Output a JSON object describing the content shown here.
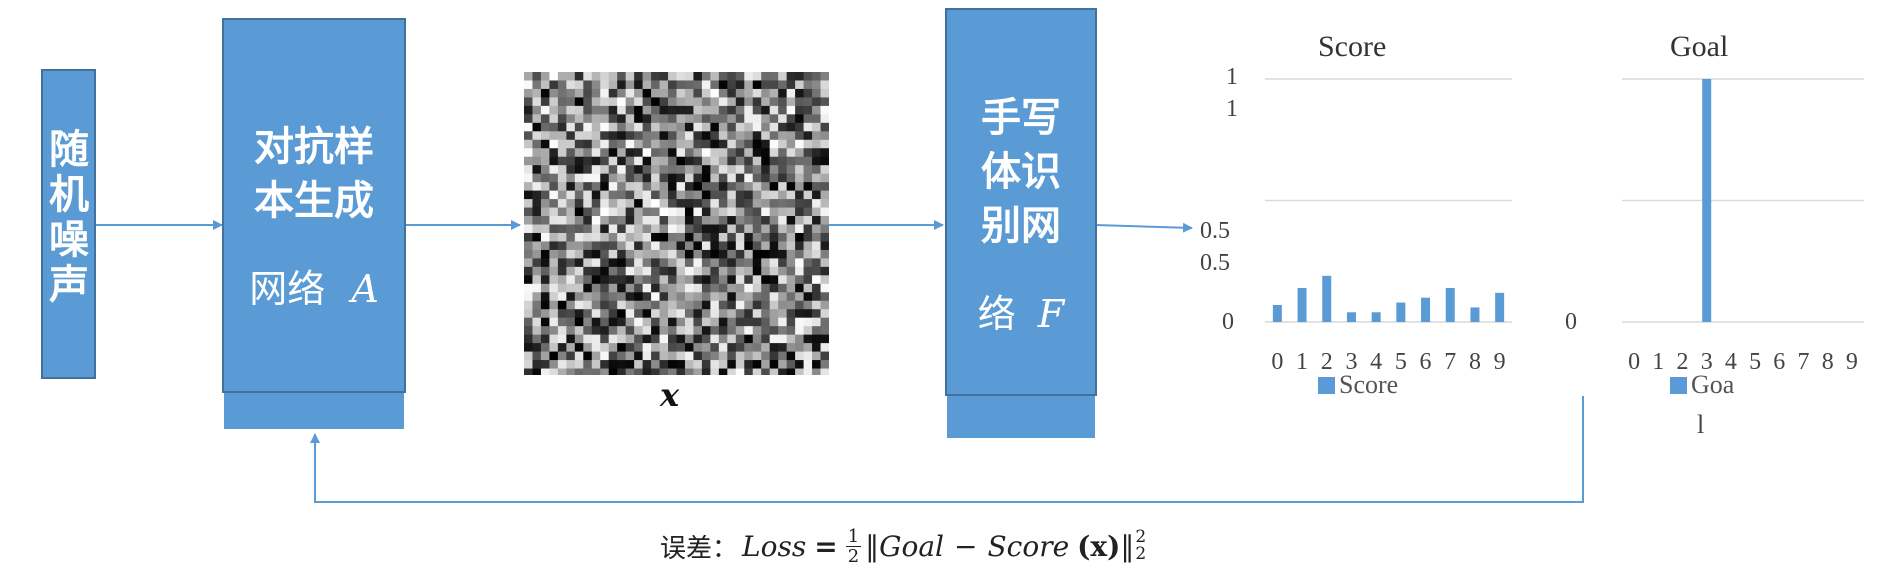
{
  "boxes": {
    "noise": {
      "label": "随机噪声"
    },
    "generator": {
      "line1": "对抗样",
      "line2": "本生成",
      "line3": "网络",
      "var": "A"
    },
    "recognizer": {
      "line1": "手写",
      "line2": "体识",
      "line3": "别网",
      "line4": "络",
      "var": "F"
    }
  },
  "sample_label": "x",
  "loss_formula": {
    "prefix": "误差：",
    "loss": "Loss",
    "equals": "=",
    "frac_num": "1",
    "frac_den": "2",
    "norm_open": "‖",
    "goal": "Goal",
    "minus": "−",
    "score": "Score",
    "arg": "(x)",
    "norm_close": "‖",
    "sup": "2",
    "sub": "2"
  },
  "colors": {
    "accent": "#5b9bd5",
    "border": "#41719c",
    "arrow": "#5b9bd5",
    "grid": "#d9d9d9"
  },
  "chart_data": [
    {
      "type": "bar",
      "title": "Score",
      "categories": [
        "0",
        "1",
        "2",
        "3",
        "4",
        "5",
        "6",
        "7",
        "8",
        "9"
      ],
      "series": [
        {
          "name": "Score",
          "values": [
            0.07,
            0.14,
            0.19,
            0.04,
            0.04,
            0.08,
            0.1,
            0.14,
            0.06,
            0.12
          ]
        }
      ],
      "ylim": [
        0,
        1
      ],
      "y_tick_labels": [
        "1",
        "1",
        "0.5",
        "0.5",
        "0"
      ],
      "grid": true,
      "legend": "bottom"
    },
    {
      "type": "bar",
      "title": "Goal",
      "categories": [
        "0",
        "1",
        "2",
        "3",
        "4",
        "5",
        "6",
        "7",
        "8",
        "9"
      ],
      "series": [
        {
          "name": "Goa",
          "values": [
            0,
            0,
            0,
            1,
            0,
            0,
            0,
            0,
            0,
            0
          ]
        }
      ],
      "ylim": [
        0,
        1
      ],
      "y_tick_labels": [
        "0"
      ],
      "grid": true,
      "legend": "bottom",
      "legend_wrap": "l"
    }
  ]
}
